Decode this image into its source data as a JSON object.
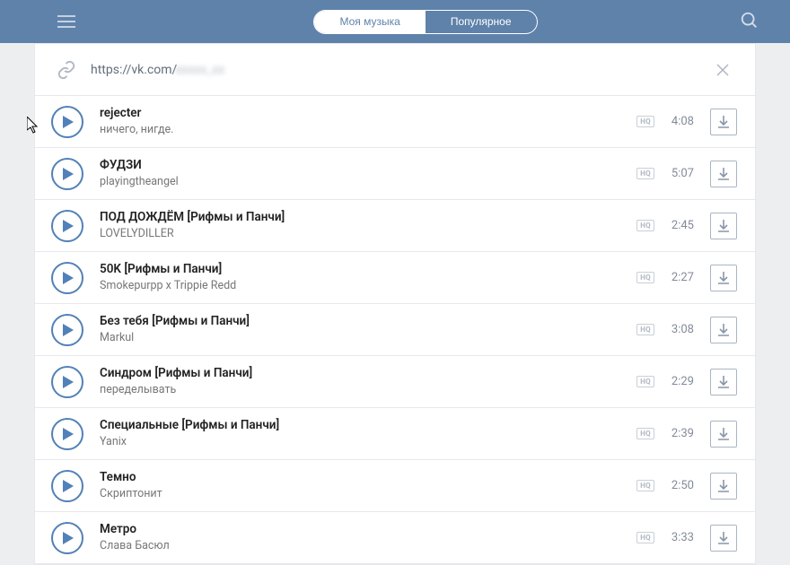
{
  "header": {
    "tabs": {
      "my_music": "Моя музыка",
      "popular": "Популярное"
    }
  },
  "url_bar": {
    "url_prefix": "https://vk.com/",
    "url_suffix_obscured": "xxxxx_xx"
  },
  "tracks": [
    {
      "title": "rejecter",
      "artist": "ничего, нигде.",
      "duration": "4:08",
      "hq": "HQ"
    },
    {
      "title": "ФУДЗИ",
      "artist": "playingtheangel",
      "duration": "5:07",
      "hq": "HQ"
    },
    {
      "title": "ПОД ДОЖДЁМ [Рифмы и Панчи]",
      "artist": "LOVELYDILLER",
      "duration": "2:45",
      "hq": "HQ"
    },
    {
      "title": "50K [Рифмы и Панчи]",
      "artist": "Smokepurpp x Trippie Redd",
      "duration": "2:27",
      "hq": "HQ"
    },
    {
      "title": "Без тебя [Рифмы и Панчи]",
      "artist": "Markul",
      "duration": "3:08",
      "hq": "HQ"
    },
    {
      "title": "Синдром [Рифмы и Панчи]",
      "artist": "переделывать",
      "duration": "2:29",
      "hq": "HQ"
    },
    {
      "title": "Специальные [Рифмы и Панчи]",
      "artist": "Yanix",
      "duration": "2:39",
      "hq": "HQ"
    },
    {
      "title": "Темно",
      "artist": "Скриптонит",
      "duration": "2:50",
      "hq": "HQ"
    },
    {
      "title": "Метро",
      "artist": "Слава Басюл",
      "duration": "3:33",
      "hq": "HQ"
    }
  ]
}
